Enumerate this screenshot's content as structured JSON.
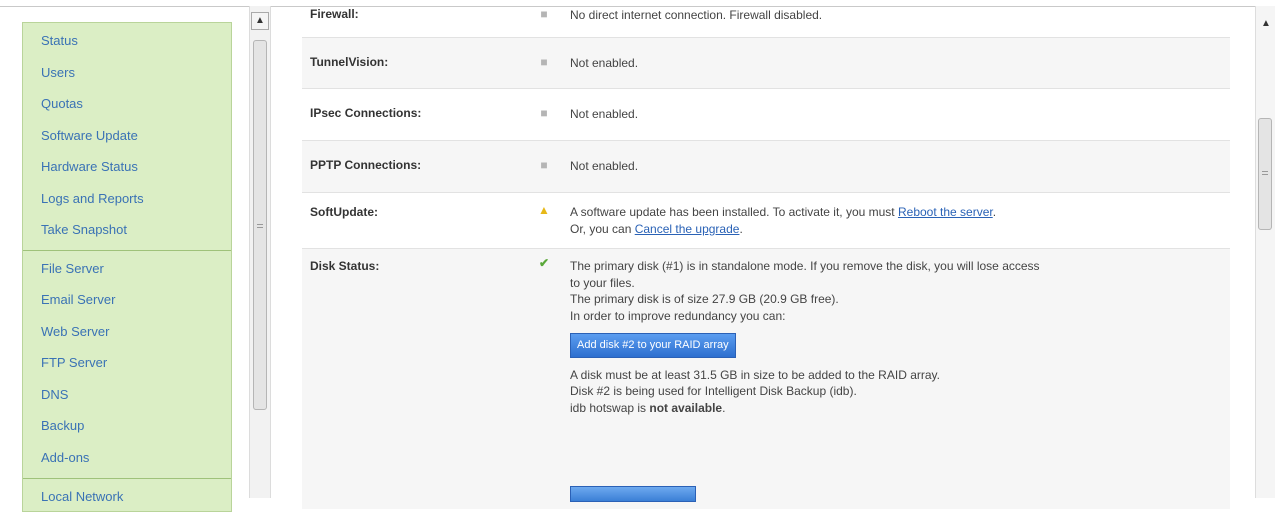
{
  "sidebar": {
    "group1": [
      "Status",
      "Users",
      "Quotas",
      "Software Update",
      "Hardware Status",
      "Logs and Reports",
      "Take Snapshot"
    ],
    "group2": [
      "File Server",
      "Email Server",
      "Web Server",
      "FTP Server",
      "DNS",
      "Backup",
      "Add-ons"
    ],
    "group3": [
      "Local Network"
    ]
  },
  "rows": {
    "firewall": {
      "label": "Firewall:",
      "text": "No direct internet connection. Firewall disabled."
    },
    "tunnelvision": {
      "label": "TunnelVision:",
      "text": "Not enabled."
    },
    "ipsec": {
      "label": "IPsec Connections:",
      "text": "Not enabled."
    },
    "pptp": {
      "label": "PPTP Connections:",
      "text": "Not enabled."
    },
    "softupdate": {
      "label": "SoftUpdate:",
      "line1_pre": "A software update has been installed. To activate it, you must ",
      "line1_link": "Reboot the server",
      "line1_post": ".",
      "line2_pre": "Or, you can ",
      "line2_link": "Cancel the upgrade",
      "line2_post": "."
    },
    "disk": {
      "label": "Disk Status:",
      "line1": "The primary disk (#1) is in standalone mode. If you remove the disk, you will lose access",
      "line2": "to your files.",
      "line3": "The primary disk is of size 27.9 GB (20.9 GB free).",
      "line4": "In order to improve redundancy you can:",
      "button": "Add disk #2 to your RAID array",
      "line5": "A disk must be at least 31.5 GB in size to be added to the RAID array.",
      "line6": "Disk #2 is being used for Intelligent Disk Backup (idb).",
      "line7_pre": "idb hotswap is ",
      "line7_bold": "not available",
      "line7_post": "."
    }
  },
  "glyphs": {
    "bullet": "■",
    "warn": "▲",
    "ok": "✔",
    "up": "▲"
  },
  "colors": {
    "sidebar_bg": "#dbeec5",
    "link": "#3a72b5",
    "button": "#2d6fcf",
    "warn": "#e7b817",
    "ok": "#5aa83a"
  }
}
